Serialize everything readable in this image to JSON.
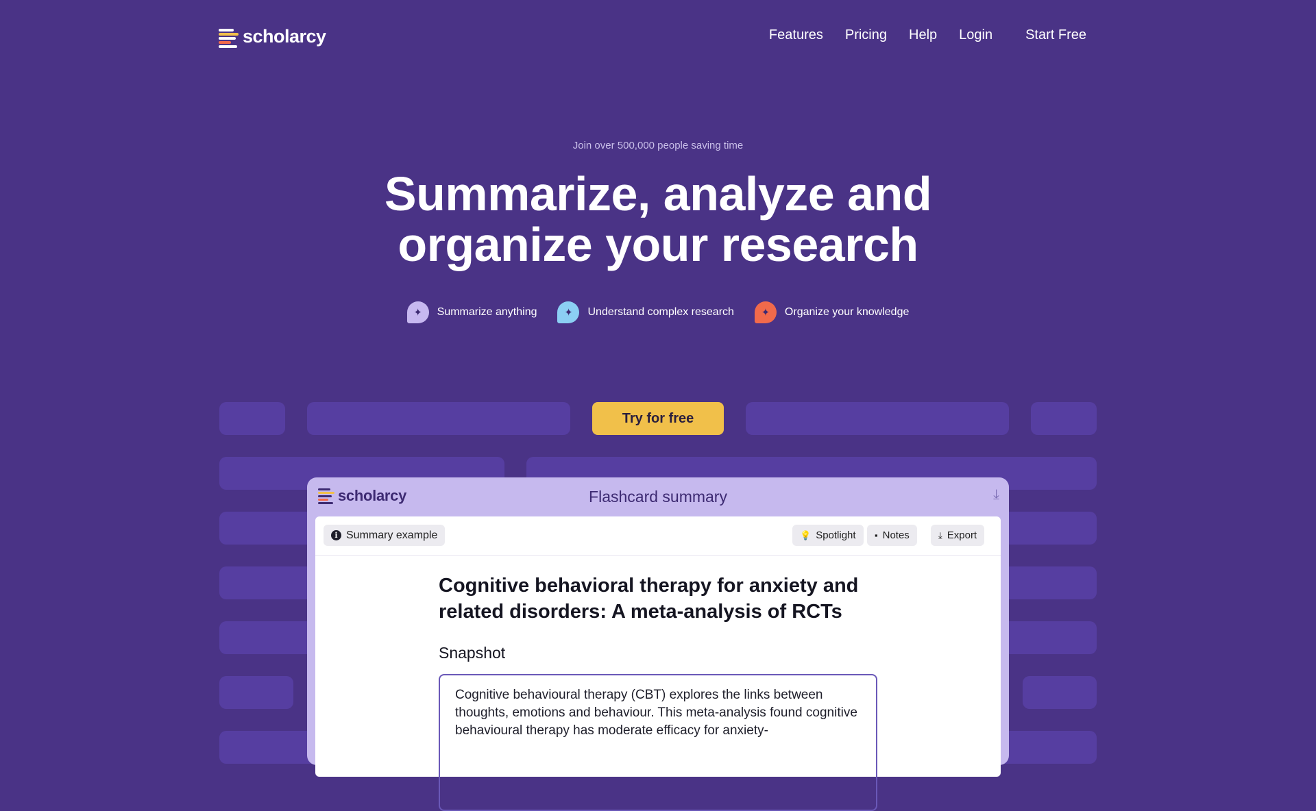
{
  "brand": {
    "name": "scholarcy"
  },
  "nav": {
    "links": [
      "Features",
      "Pricing",
      "Help",
      "Login"
    ],
    "start": "Start Free"
  },
  "hero": {
    "tagline": "Join over 500,000 people saving time",
    "headline_line1": "Summarize, analyze and",
    "headline_line2": "organize your research",
    "features": [
      {
        "label": "Summarize anything",
        "color": "#c7b8f0",
        "icon": "sparkle-icon"
      },
      {
        "label": "Understand complex research",
        "color": "#8ccff4",
        "icon": "sparkle-icon"
      },
      {
        "label": "Organize your knowledge",
        "color": "#f26a4b",
        "icon": "sparkle-icon"
      }
    ],
    "cta": "Try for free"
  },
  "app": {
    "brand": "scholarcy",
    "title": "Flashcard summary",
    "toolbar": {
      "example": "Summary example",
      "spotlight": "Spotlight",
      "notes": "Notes",
      "export": "Export"
    },
    "doc_title": "Cognitive behavioral therapy for anxiety and related disorders: A meta-analysis of RCTs",
    "snapshot_heading": "Snapshot",
    "snapshot_text": "Cognitive behavioural therapy (CBT) explores the links between thoughts, emotions and behaviour. This meta-analysis found cognitive behavioural therapy has moderate efficacy for anxiety-"
  },
  "colors": {
    "background": "#4a3386",
    "block": "#563ea1",
    "cta": "#f1c04a",
    "app_frame": "#c6b9ee"
  }
}
